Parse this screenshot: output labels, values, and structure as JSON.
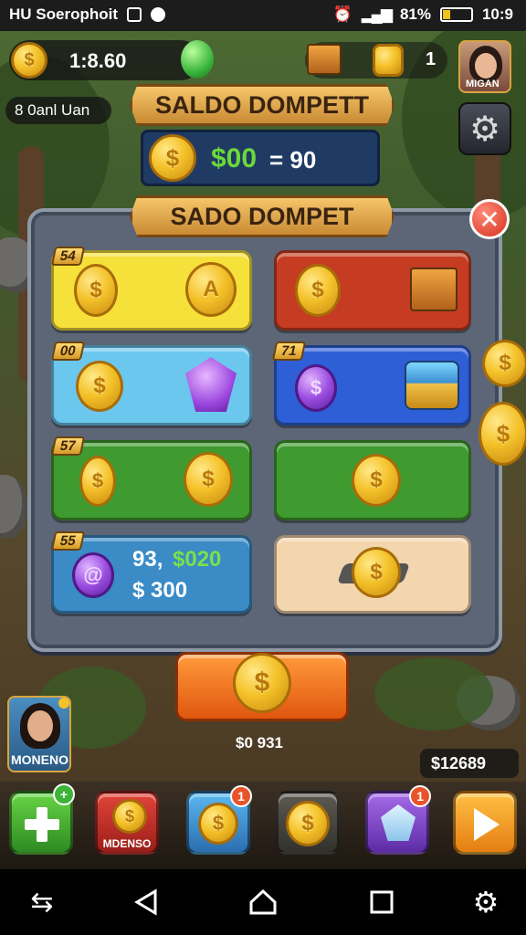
{
  "status_bar": {
    "carrier": "HU Soerophoit",
    "battery": "81%",
    "time": "10:9"
  },
  "hud": {
    "coin_balance": "1:8.60",
    "crate_count": "1",
    "player_name": "MIGAN",
    "left_label": "8 0anl Uan"
  },
  "wallet": {
    "banner_title": "SALDO DOMPETT",
    "amount_green": "$00",
    "amount_white": "= 90"
  },
  "panel": {
    "title": "SADO DOMPET",
    "tiles": [
      {
        "tag": "54",
        "color": "#f6e13a"
      },
      {
        "tag": "",
        "color": "#c53c22"
      },
      {
        "tag": "00",
        "color": "#6cc7ef"
      },
      {
        "tag": "71",
        "color": "#2f5fd6"
      },
      {
        "tag": "57",
        "color": "#3f9a2f"
      },
      {
        "tag": "",
        "color": "#3f9a2f"
      },
      {
        "tag": "55",
        "color": "#3a8bc6",
        "line1_white": "93,",
        "line1_green": "$020",
        "line2": "$ 300"
      },
      {
        "tag": "",
        "color": "#f3d5ae"
      }
    ]
  },
  "collect": {
    "amount_label": "$0 931"
  },
  "profile": {
    "name": "MONENO"
  },
  "bottom_right_balance": "$12689",
  "dock": {
    "shop_label": "MDENSO",
    "badges": [
      "1",
      "1"
    ]
  },
  "colors": {
    "accent_gold": "#f4c22a",
    "panel": "#5c6677",
    "nav": "#000000"
  }
}
